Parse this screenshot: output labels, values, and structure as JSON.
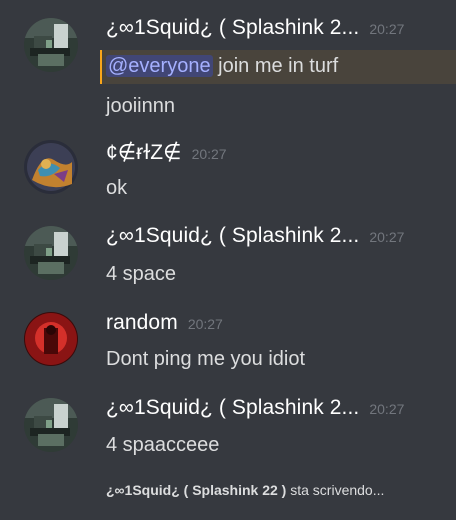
{
  "messages": [
    {
      "author": "¿∞1Squid¿ ( Splashink 2...",
      "time": "20:27",
      "lines": [
        {
          "mention": "@everyone",
          "text": " join me in turf"
        },
        {
          "text": "jooiinnn"
        }
      ]
    },
    {
      "author": "¢∉ɍɫZ∉",
      "time": "20:27",
      "lines": [
        {
          "text": "ok"
        }
      ]
    },
    {
      "author": "¿∞1Squid¿ ( Splashink 2...",
      "time": "20:27",
      "lines": [
        {
          "text": "4 space"
        }
      ]
    },
    {
      "author": "random",
      "time": "20:27",
      "lines": [
        {
          "text": "Dont ping me you idiot"
        }
      ]
    },
    {
      "author": "¿∞1Squid¿ ( Splashink 2...",
      "time": "20:27",
      "lines": [
        {
          "text": "4 spaacceee"
        }
      ]
    }
  ],
  "typing": {
    "user": "¿∞1Squid¿ ( Splashink 22 )",
    "suffix": " sta scrivendo..."
  },
  "colors": {
    "background": "#36393f",
    "mention_highlight": "#49443c",
    "mention_border": "#faa61a",
    "mention_text": "#a5b0ff"
  }
}
